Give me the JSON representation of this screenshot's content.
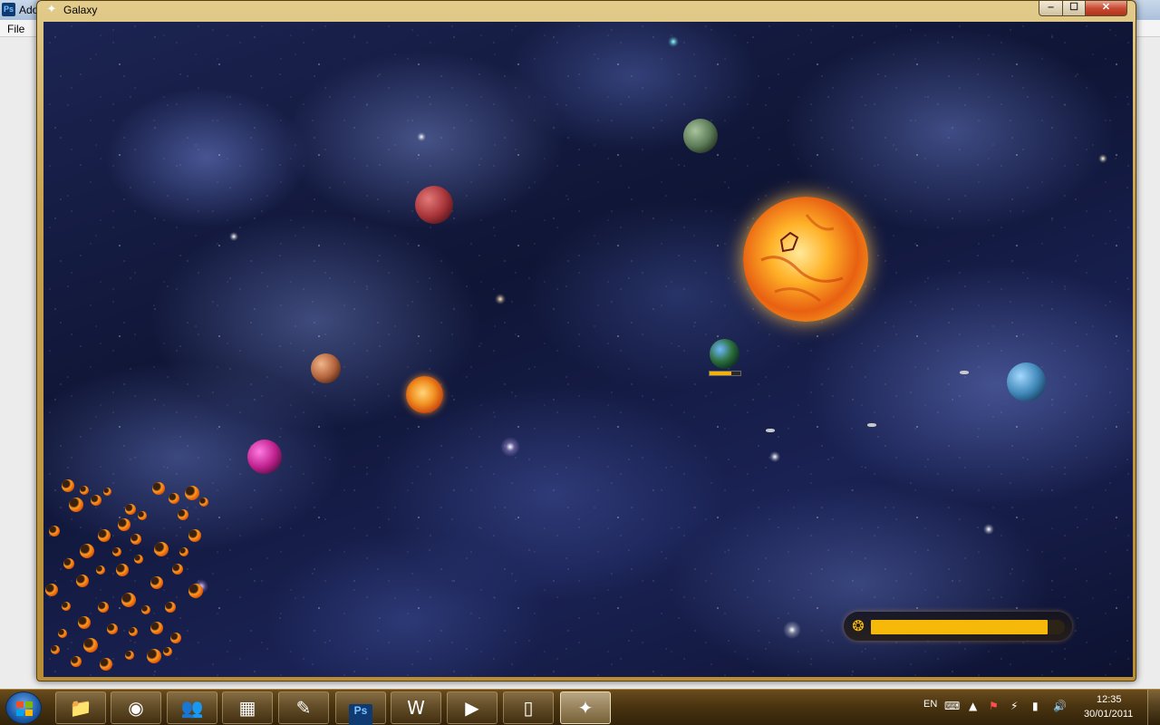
{
  "background_app": {
    "title": "Ado",
    "icon": "Ps",
    "menu": [
      "File"
    ]
  },
  "window": {
    "title": "Galaxy",
    "icon": "gamepad-icon",
    "controls": {
      "minimize": "‒",
      "maximize": "☐",
      "close": "✕"
    }
  },
  "game": {
    "planets": [
      {
        "name": "green-planet",
        "color": "#5b7a56"
      },
      {
        "name": "red-planet",
        "color": "#a8343a"
      },
      {
        "name": "sun",
        "color": "#f8a41c"
      },
      {
        "name": "earth-planet",
        "color": "#2b6e3a",
        "progress": 0.7
      },
      {
        "name": "blue-planet",
        "color": "#3f87b8"
      },
      {
        "name": "orange-planet",
        "color": "#b4643c"
      },
      {
        "name": "fire-planet",
        "color": "#f29222"
      },
      {
        "name": "magenta-planet",
        "color": "#c0218e"
      }
    ],
    "energy": {
      "icon": "rocket-icon",
      "level": 0.91,
      "color": "#f6b90a"
    }
  },
  "taskbar": {
    "start": "windows-start",
    "items": [
      {
        "name": "explorer",
        "icon": "folder-icon"
      },
      {
        "name": "firefox",
        "icon": "firefox-icon"
      },
      {
        "name": "messenger",
        "icon": "messenger-icon"
      },
      {
        "name": "calculator",
        "icon": "calculator-icon"
      },
      {
        "name": "notepad",
        "icon": "notepad-icon"
      },
      {
        "name": "photoshop",
        "icon": "photoshop-icon",
        "label": "Ps"
      },
      {
        "name": "word",
        "icon": "word-icon"
      },
      {
        "name": "media-player",
        "icon": "media-player-icon"
      },
      {
        "name": "device",
        "icon": "device-icon"
      },
      {
        "name": "galaxy",
        "icon": "gamepad-icon",
        "active": true
      }
    ],
    "tray": {
      "language": "EN",
      "time": "12:35",
      "date": "30/01/2011"
    }
  }
}
